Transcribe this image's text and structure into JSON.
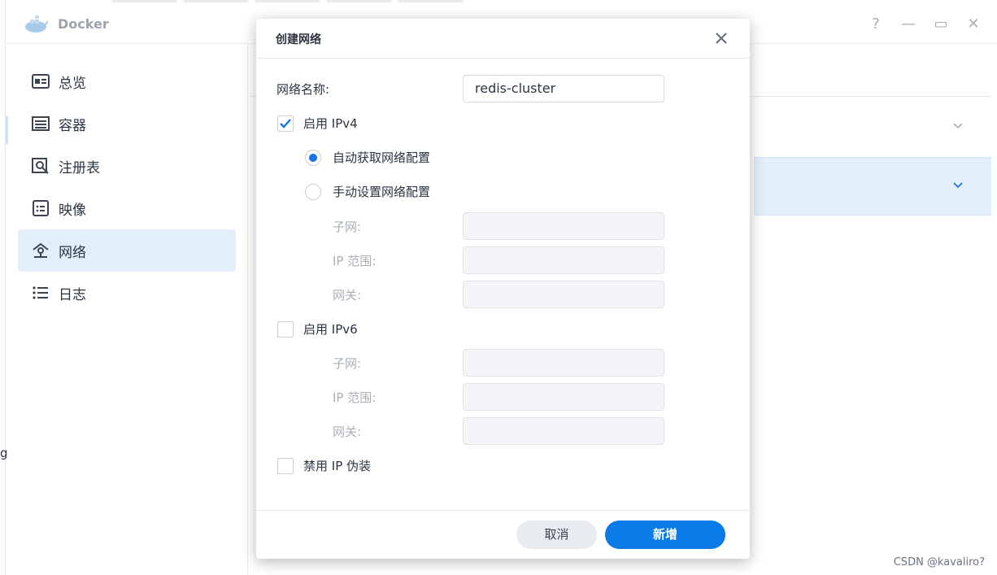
{
  "window": {
    "title": "Docker",
    "controls": {
      "help": "?",
      "minimize": "—",
      "maximize": "▭",
      "close": "✕"
    }
  },
  "sidebar": {
    "items": [
      {
        "label": "总览",
        "icon": "overview-icon"
      },
      {
        "label": "容器",
        "icon": "container-icon"
      },
      {
        "label": "注册表",
        "icon": "registry-icon"
      },
      {
        "label": "映像",
        "icon": "image-icon"
      },
      {
        "label": "网络",
        "icon": "network-icon",
        "active": true
      },
      {
        "label": "日志",
        "icon": "log-icon"
      }
    ]
  },
  "stray_text": "g",
  "dialog": {
    "title": "创建网络",
    "network_name_label": "网络名称:",
    "network_name_value": "redis-cluster",
    "ipv4": {
      "label": "启用 IPv4",
      "checked": true,
      "auto_label": "自动获取网络配置",
      "manual_label": "手动设置网络配置",
      "subnet_label": "子网:",
      "ip_range_label": "IP 范围:",
      "gateway_label": "网关:"
    },
    "ipv6": {
      "label": "启用 IPv6",
      "checked": false,
      "subnet_label": "子网:",
      "ip_range_label": "IP 范围:",
      "gateway_label": "网关:"
    },
    "masquerade_label": "禁用 IP 伪装",
    "cancel_label": "取消",
    "submit_label": "新增"
  },
  "watermark": "CSDN @kavaliro?",
  "colors": {
    "accent": "#0a7ae6",
    "active_bg": "#e3eefb"
  }
}
